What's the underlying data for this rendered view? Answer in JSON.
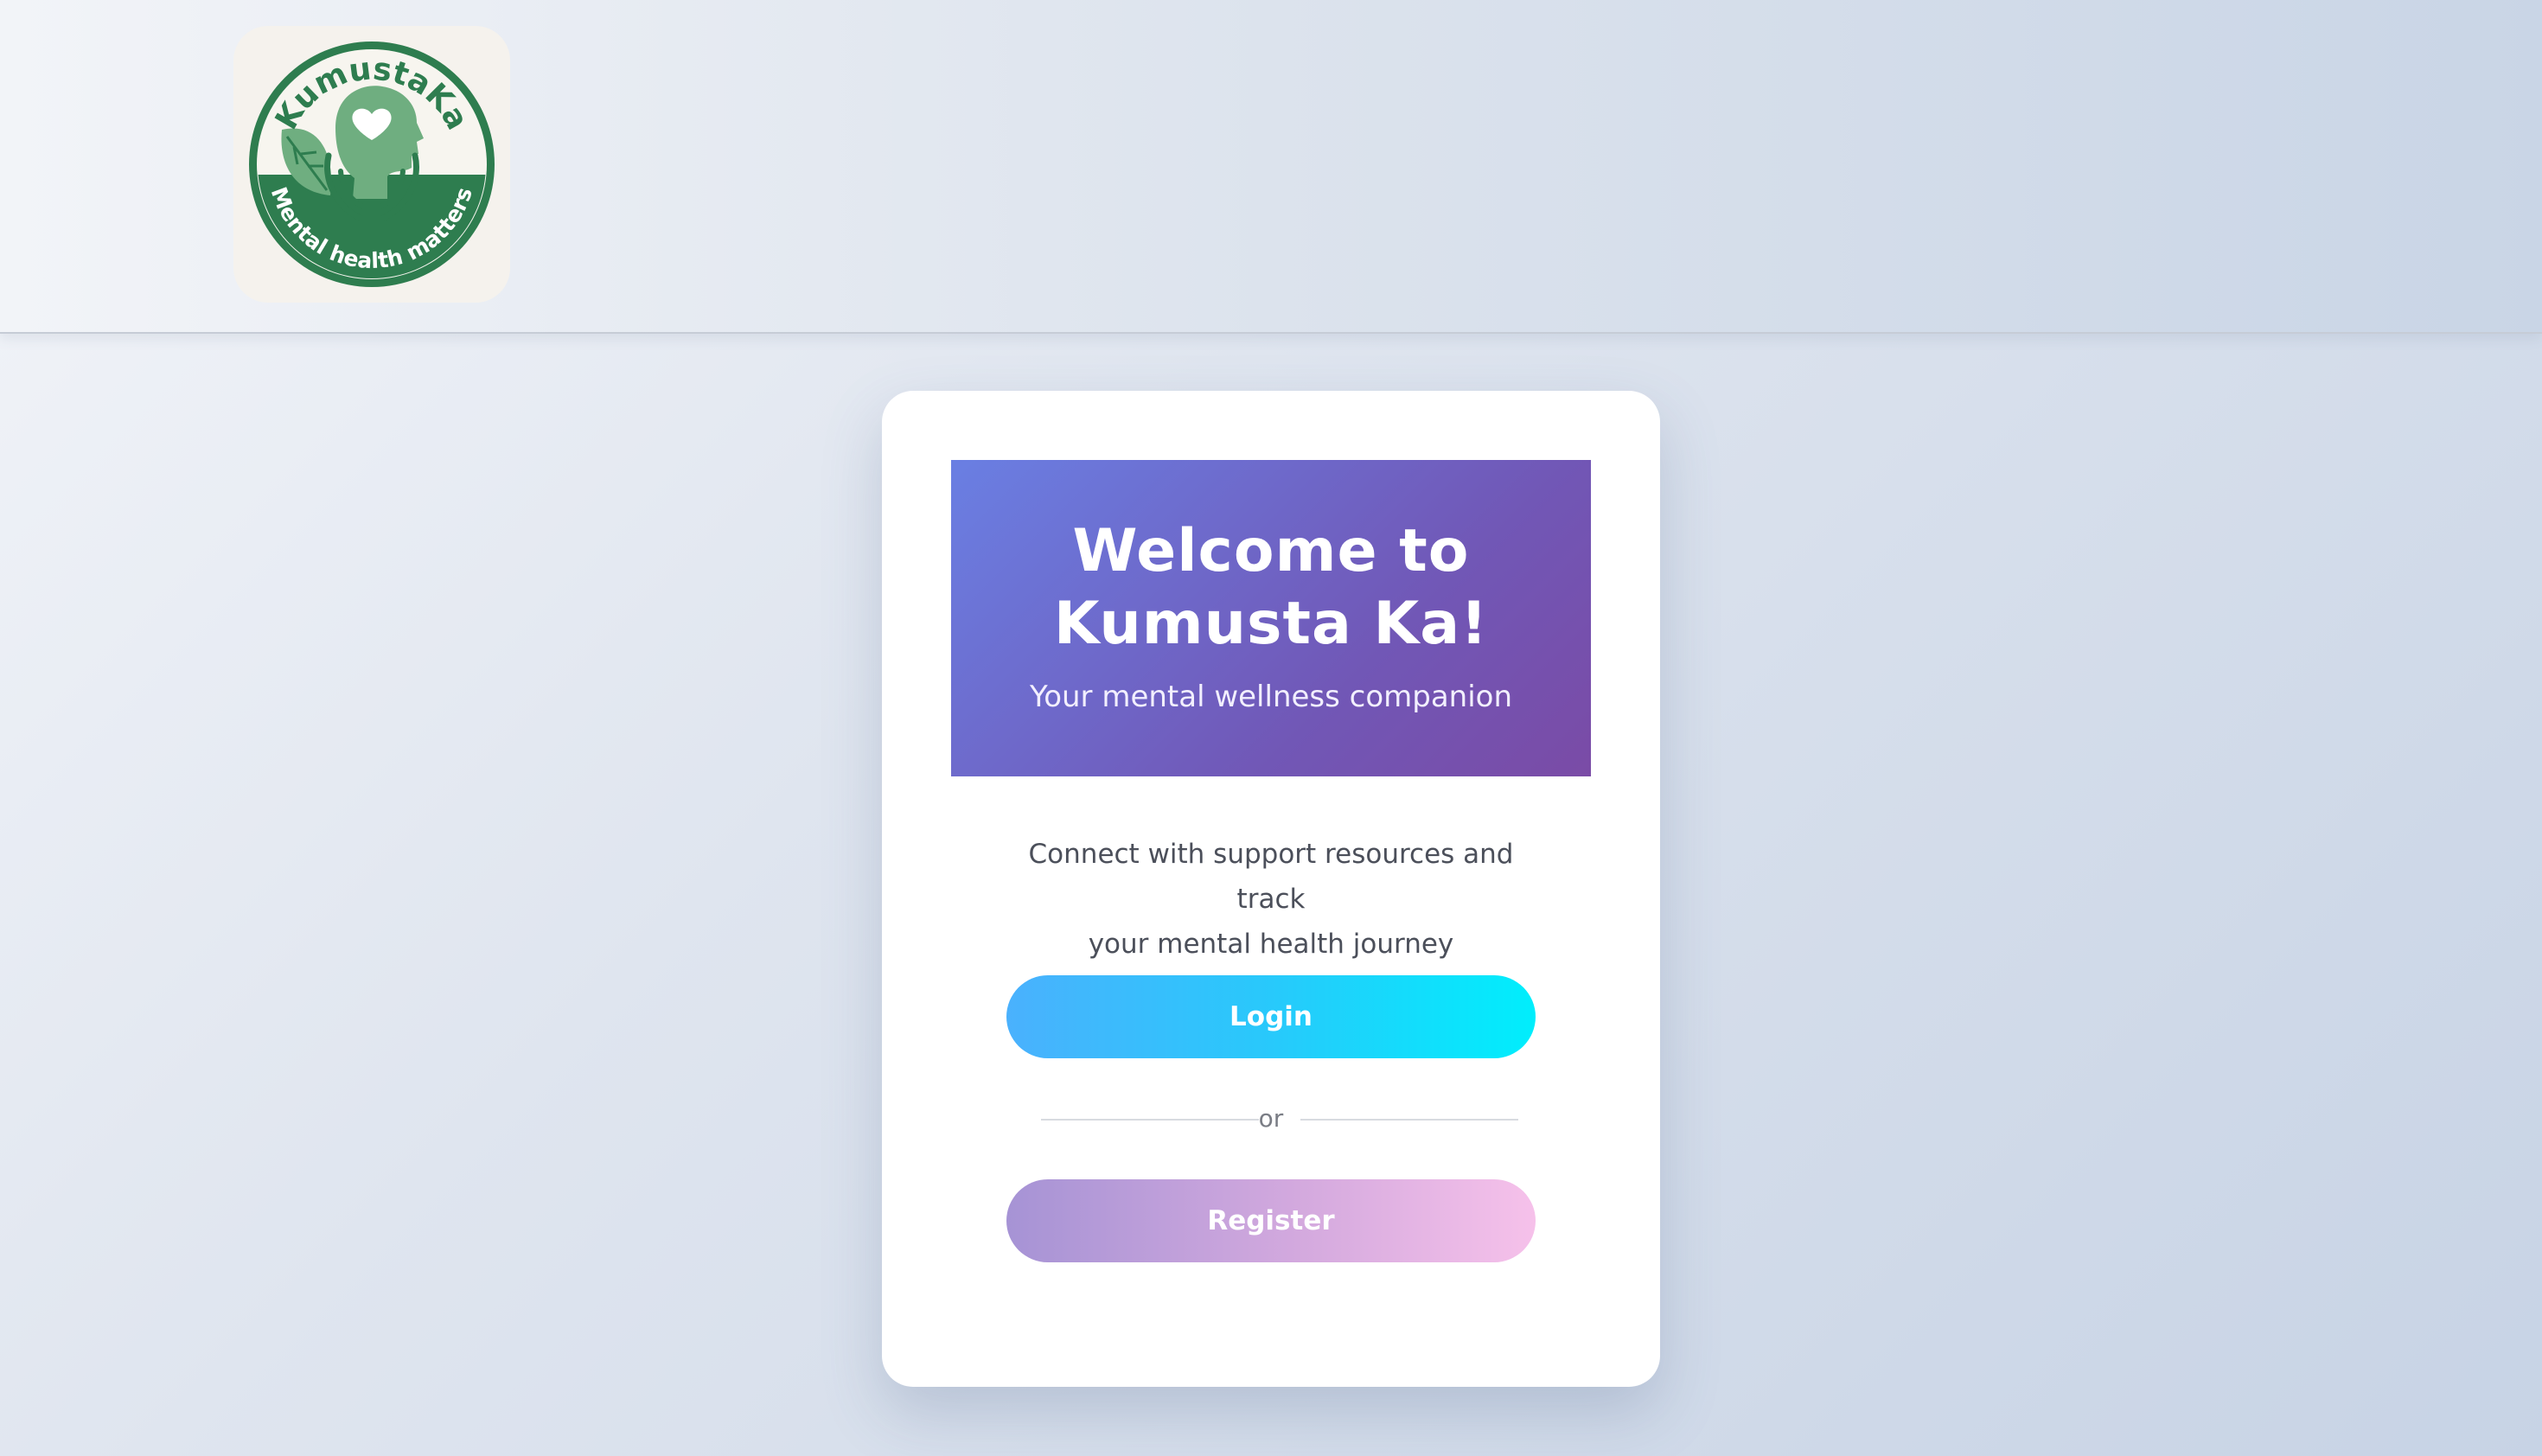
{
  "brand": {
    "logo_wordmark": "KumustaKa",
    "logo_tagline": "Mental health matters",
    "primary_color": "#2e7d4f",
    "logo_icon": "heart-head-hands-leaf-icon"
  },
  "hero": {
    "title_line1": "Welcome to",
    "title_line2": "Kumusta Ka!",
    "subtitle": "Your mental wellness companion"
  },
  "description": {
    "line1": "Connect with support resources and track",
    "line2": "your mental health journey"
  },
  "actions": {
    "login_label": "Login",
    "divider_text": "or",
    "register_label": "Register"
  },
  "colors": {
    "hero_gradient_start": "#6a7fe3",
    "hero_gradient_end": "#7a4ba6",
    "login_gradient_start": "#4ab1fd",
    "login_gradient_end": "#00eefc",
    "register_gradient_start": "#a693d5",
    "register_gradient_end": "#f6c1ea"
  }
}
